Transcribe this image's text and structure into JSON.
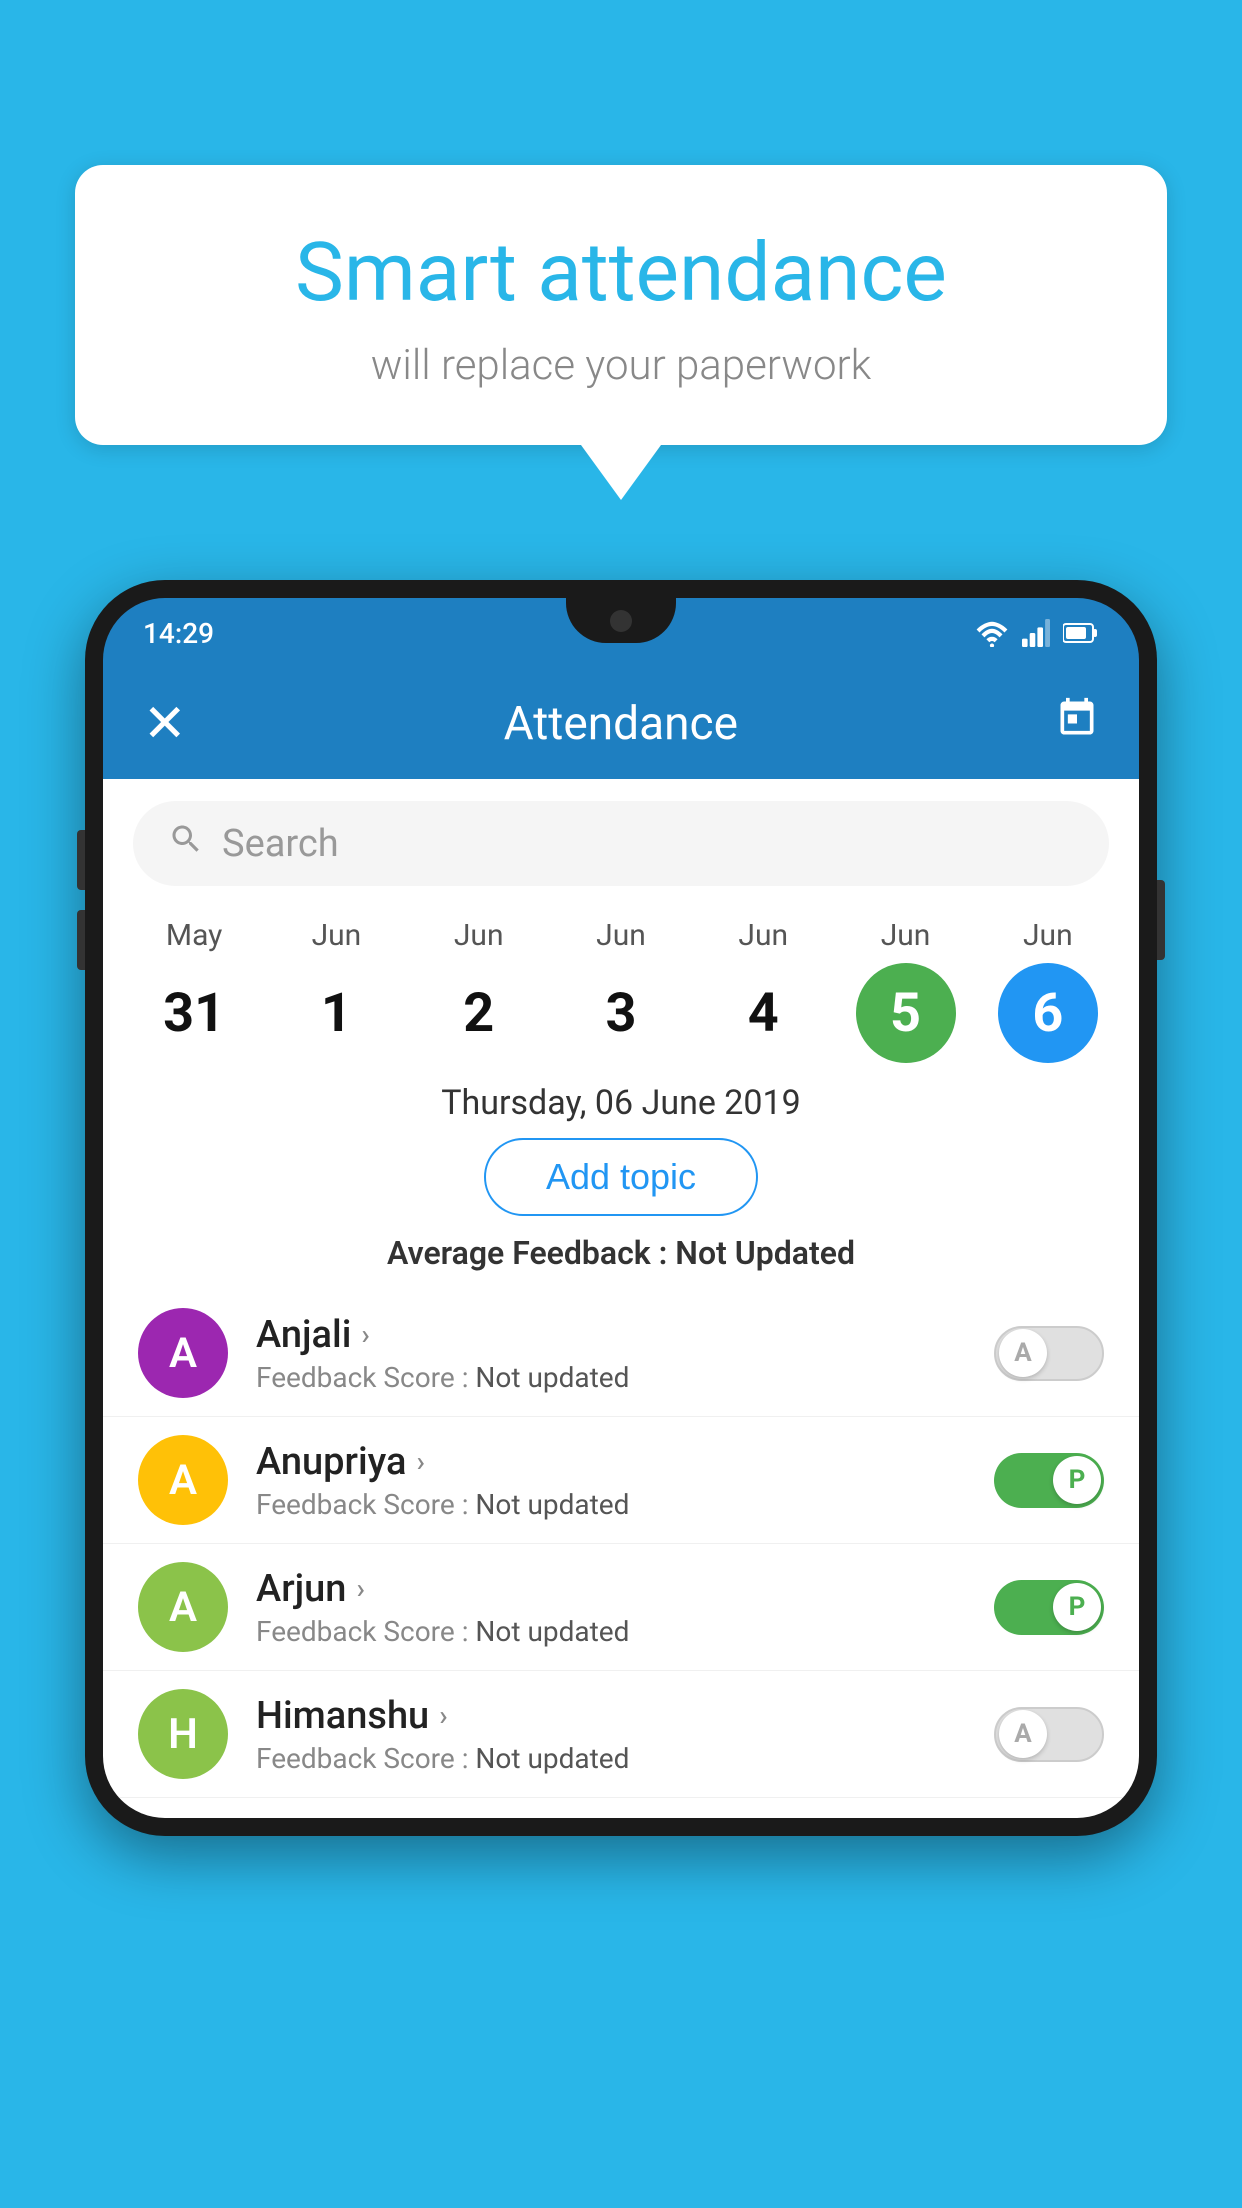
{
  "background_color": "#29b6e8",
  "speech_bubble": {
    "heading": "Smart attendance",
    "subtext": "will replace your paperwork"
  },
  "phone": {
    "status_bar": {
      "time": "14:29"
    },
    "header": {
      "title": "Attendance",
      "close_label": "✕",
      "calendar_icon": "📅"
    },
    "search": {
      "placeholder": "Search"
    },
    "calendar": {
      "days": [
        {
          "month": "May",
          "date": "31",
          "state": "normal"
        },
        {
          "month": "Jun",
          "date": "1",
          "state": "normal"
        },
        {
          "month": "Jun",
          "date": "2",
          "state": "normal"
        },
        {
          "month": "Jun",
          "date": "3",
          "state": "normal"
        },
        {
          "month": "Jun",
          "date": "4",
          "state": "normal"
        },
        {
          "month": "Jun",
          "date": "5",
          "state": "today"
        },
        {
          "month": "Jun",
          "date": "6",
          "state": "selected"
        }
      ]
    },
    "selected_date_label": "Thursday, 06 June 2019",
    "add_topic_label": "Add topic",
    "avg_feedback_label": "Average Feedback :",
    "avg_feedback_value": "Not Updated",
    "students": [
      {
        "name": "Anjali",
        "feedback_label": "Feedback Score :",
        "feedback_value": "Not updated",
        "avatar_letter": "A",
        "avatar_color": "#9c27b0",
        "toggle_state": "off",
        "toggle_label": "A"
      },
      {
        "name": "Anupriya",
        "feedback_label": "Feedback Score :",
        "feedback_value": "Not updated",
        "avatar_letter": "A",
        "avatar_color": "#ffc107",
        "toggle_state": "on",
        "toggle_label": "P"
      },
      {
        "name": "Arjun",
        "feedback_label": "Feedback Score :",
        "feedback_value": "Not updated",
        "avatar_letter": "A",
        "avatar_color": "#8bc34a",
        "toggle_state": "on",
        "toggle_label": "P"
      },
      {
        "name": "Himanshu",
        "feedback_label": "Feedback Score :",
        "feedback_value": "Not updated",
        "avatar_letter": "H",
        "avatar_color": "#8bc34a",
        "toggle_state": "off",
        "toggle_label": "A"
      }
    ]
  }
}
